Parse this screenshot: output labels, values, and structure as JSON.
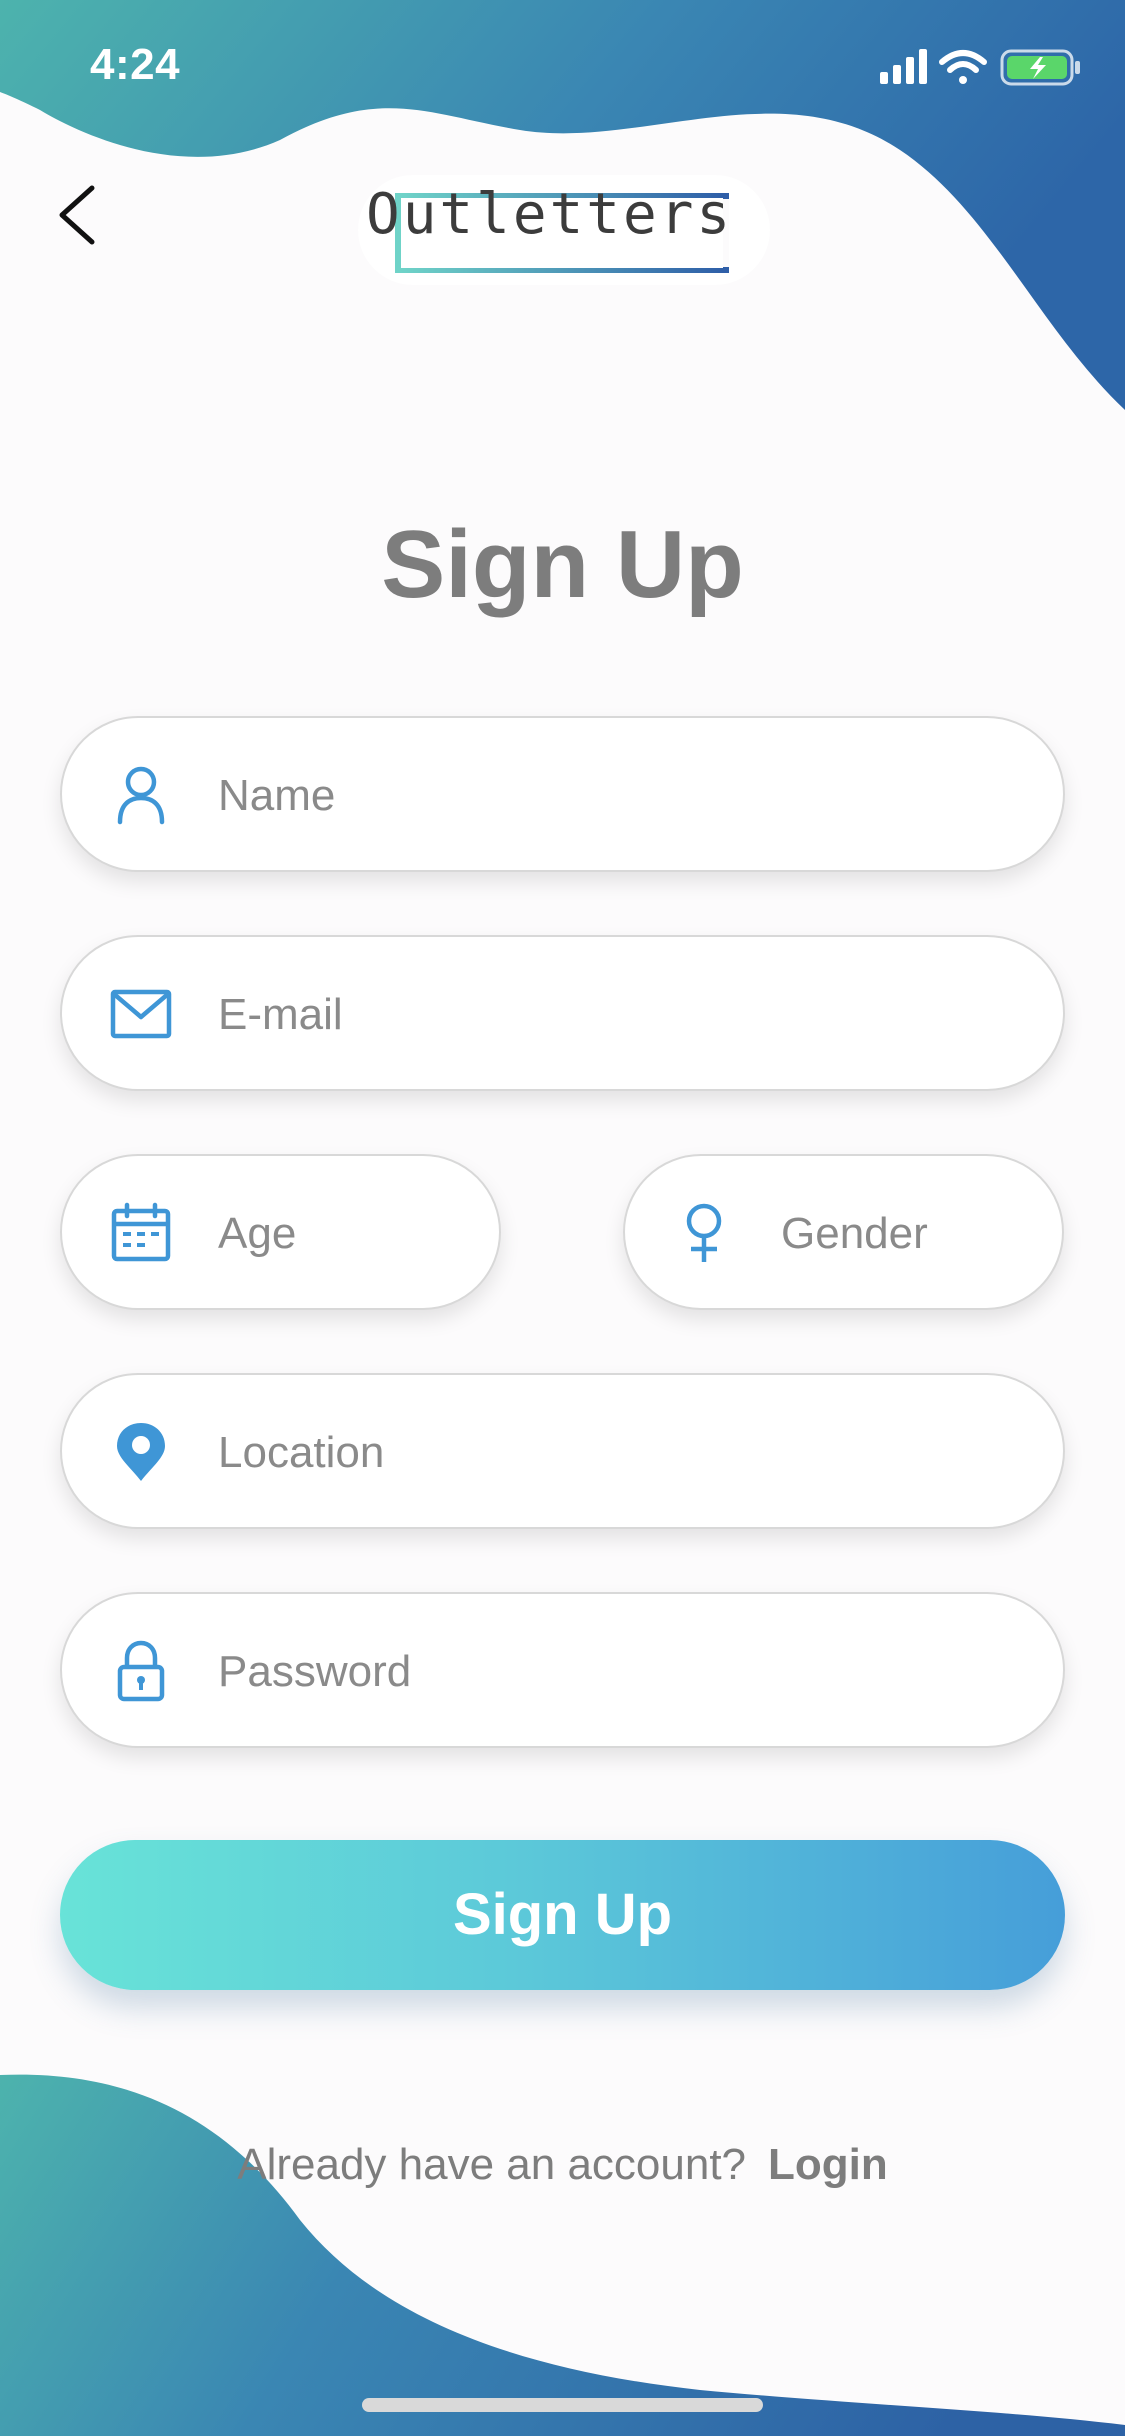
{
  "status_bar": {
    "time": "4:24"
  },
  "header": {
    "back_icon": "chevron-left-icon",
    "logo_text": "Outletters"
  },
  "title": "Sign Up",
  "form": {
    "name_placeholder": "Name",
    "email_placeholder": "E-mail",
    "age_placeholder": "Age",
    "gender_placeholder": "Gender",
    "location_placeholder": "Location",
    "password_placeholder": "Password",
    "icons": [
      "person-icon",
      "mail-icon",
      "calendar-icon",
      "female-symbol-icon",
      "location-pin-icon",
      "lock-icon"
    ],
    "submit_label": "Sign Up"
  },
  "footer": {
    "prompt": "Already have an account?",
    "login_label": "Login"
  },
  "colors": {
    "gradient_teal": "#4fb7b0",
    "gradient_blue": "#2f6aa8",
    "icon_blue": "#3f96d6",
    "button_start": "#68e3d8",
    "button_end": "#469ed9",
    "text_gray": "#7d7d7d"
  }
}
